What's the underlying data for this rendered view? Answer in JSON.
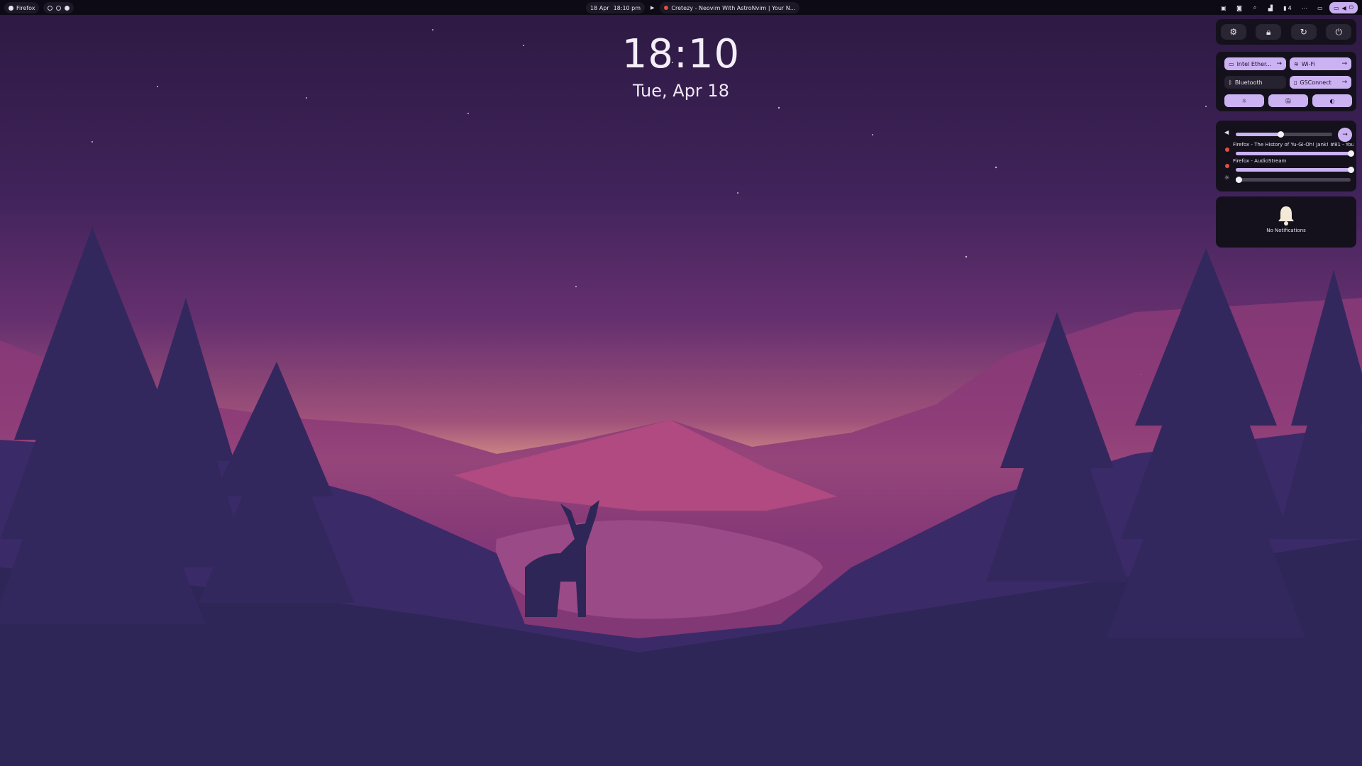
{
  "topbar": {
    "app_name": "Firefox",
    "date": "18 Apr",
    "time": "18:10 pm",
    "media_title": "Cretezy - Neovim With AstroNvim | Your N...",
    "play_icon": "▶",
    "updates_count": "4"
  },
  "clock": {
    "time": "18:10",
    "date": "Tue, Apr 18"
  },
  "quick_settings": {
    "toggles": [
      {
        "label": "Intel Ether...",
        "state": "on"
      },
      {
        "label": "Wi-Fi",
        "state": "on"
      },
      {
        "label": "Bluetooth",
        "state": "off"
      },
      {
        "label": "GSConnect",
        "state": "on"
      }
    ],
    "volume": {
      "level": 0.47
    },
    "streams": [
      {
        "label": "Firefox - The History of Yu-Gi-Oh! Jank! #81 - You...",
        "level": 1.0
      },
      {
        "label": "Firefox - AudioStream",
        "level": 1.0
      }
    ],
    "brightness": {
      "level": 0.02
    }
  },
  "notifications": {
    "empty_text": "No Notifications"
  },
  "colors": {
    "accent": "#cbb2f2",
    "panel": "#14111c",
    "bar": "#0d0a16"
  }
}
